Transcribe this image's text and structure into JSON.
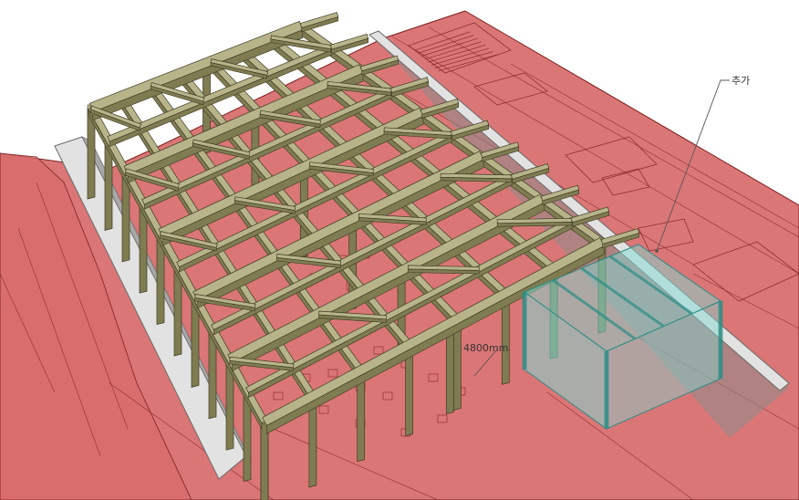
{
  "annotations": {
    "add_label": "추가",
    "dimension_label": "4800mm"
  },
  "colors": {
    "floor_plan": "#d86a6a",
    "floor_plan_line": "#7a2020",
    "timber_top": "#b8b48a",
    "timber_side": "#7f7c52",
    "timber_edge": "#3c3a22",
    "wall_cap": "#e2e2e2",
    "wall_side": "#a8a8a8",
    "glass_box": "#7fd9d2",
    "glass_edge": "#2a8c86",
    "shadow": "#8c8c8c"
  }
}
